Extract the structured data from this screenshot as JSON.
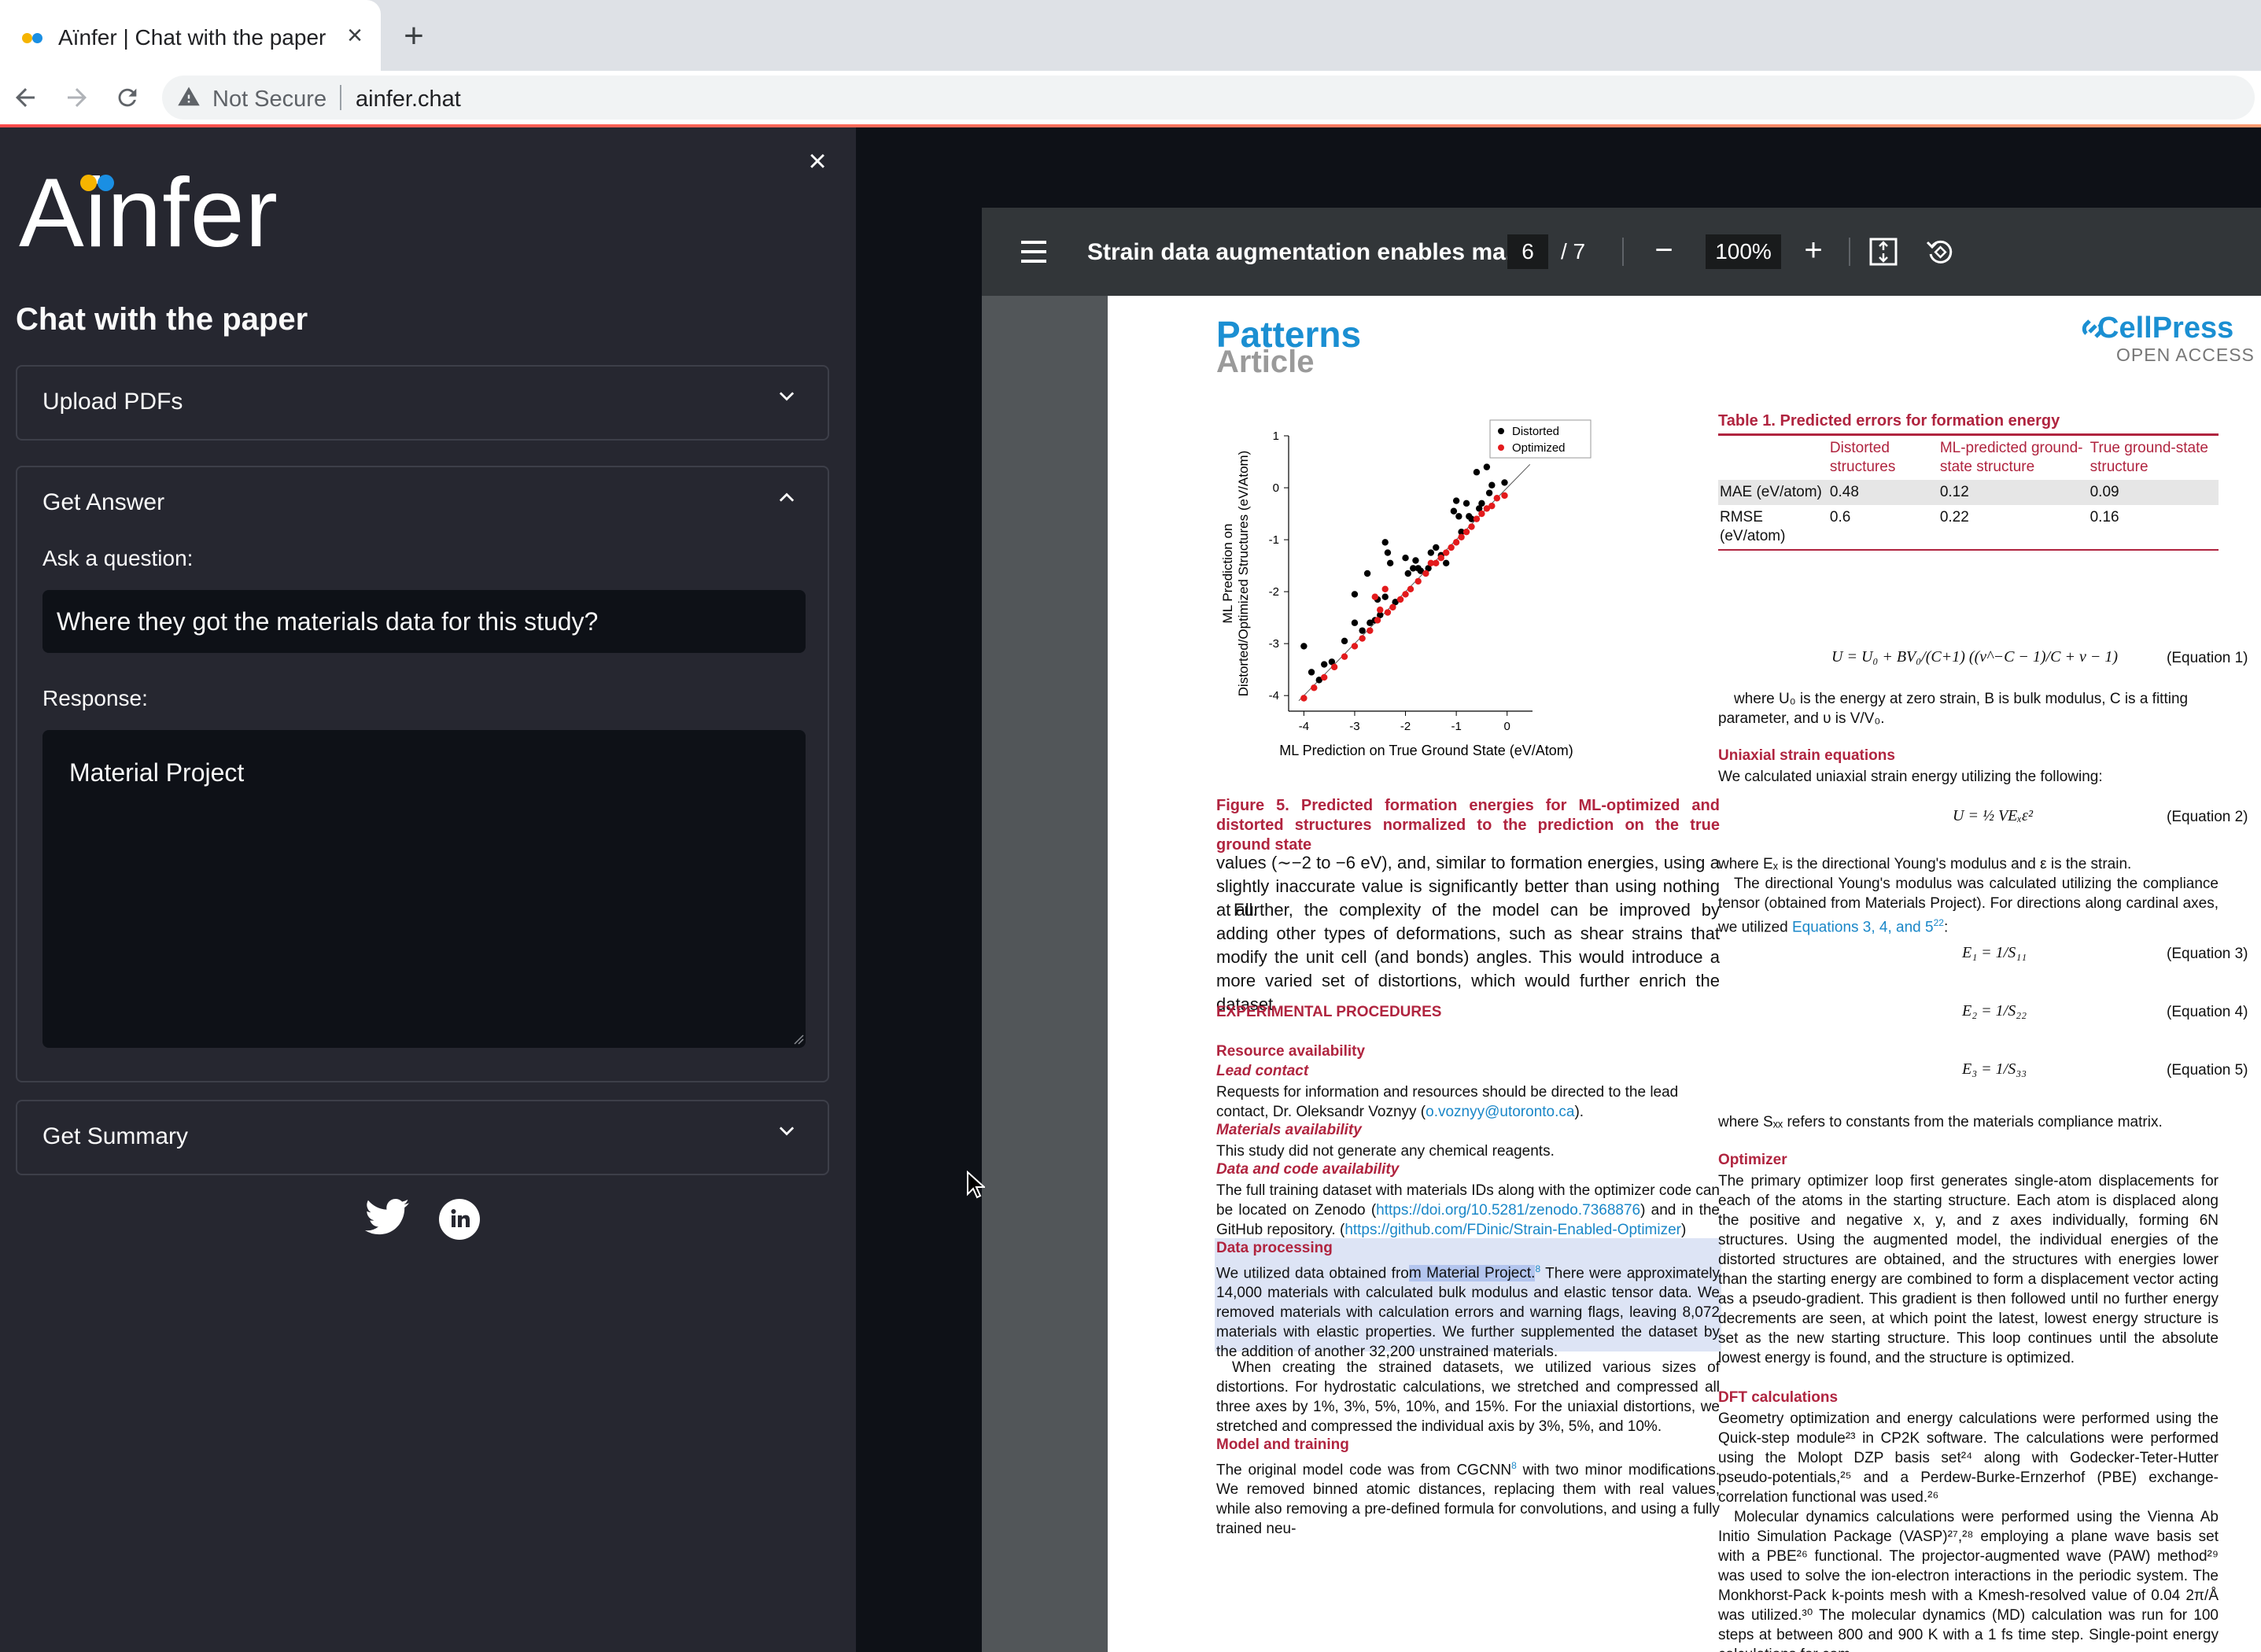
{
  "browser": {
    "tab_title": "Aïnfer | Chat with the paper",
    "not_secure": "Not Secure",
    "url": "ainfer.chat",
    "favicon_colors": [
      "#f5b400",
      "#1a8fe3"
    ]
  },
  "sidebar": {
    "logo_text": "Ainfer",
    "logo_dot_colors": [
      "#f5b400",
      "#1a8fe3"
    ],
    "subtitle": "Chat with the paper",
    "upload_label": "Upload PDFs",
    "get_answer_label": "Get Answer",
    "ask_label": "Ask a question:",
    "question_value": "Where they got the materials data for this study?",
    "response_label": "Response:",
    "response_value": "Material Project",
    "summary_label": "Get Summary",
    "socials": [
      "twitter-icon",
      "linkedin-icon"
    ]
  },
  "pdf": {
    "title": "Strain data augmentation enables ma...",
    "page": "6",
    "page_total": "/ 7",
    "zoom": "100%",
    "journal": "Patterns",
    "article_type": "Article",
    "publisher": "CellPress",
    "open_access": "OPEN ACCESS",
    "figure_caption": "Figure 5. Predicted formation energies for ML-optimized and distorted structures normalized to the prediction on the true ground state",
    "table": {
      "title": "Table 1. Predicted errors for formation energy",
      "columns": [
        "",
        "Distorted structures",
        "ML-predicted ground-state structure",
        "True ground-state structure"
      ],
      "rows": [
        [
          "MAE (eV/atom)",
          "0.48",
          "0.12",
          "0.09"
        ],
        [
          "RMSE (eV/atom)",
          "0.6",
          "0.22",
          "0.16"
        ]
      ]
    },
    "left_col": {
      "para1": "values (∼−2 to −6 eV), and, similar to formation energies, using a slightly inaccurate value is significantly better than using nothing at all.",
      "para2": "Further, the complexity of the model can be improved by adding other types of deformations, such as shear strains that modify the unit cell (and bonds) angles. This would introduce a more varied set of distortions, which would further enrich the dataset.",
      "exp_heading": "EXPERIMENTAL PROCEDURES",
      "resource_heading": "Resource availability",
      "lead_heading": "Lead contact",
      "lead_text": "Requests for information and resources should be directed to the lead contact, Dr. Oleksandr Voznyy (",
      "lead_email": "o.voznyy@utoronto.ca",
      "lead_end": ").",
      "materials_heading": "Materials availability",
      "materials_text": "This study did not generate any chemical reagents.",
      "data_code_heading": "Data and code availability",
      "data_code_text": "The full training dataset with materials IDs along with the optimizer code can be located on Zenodo (",
      "zenodo_link": "https://doi.org/10.5281/zenodo.7368876",
      "data_code_mid": ") and in the GitHub repository. (",
      "github_link": "https://github.com/FDinic/Strain-Enabled-Optimizer",
      "data_code_end": ")",
      "processing_heading": "Data processing",
      "processing_pre": "We utilized data obtained fro",
      "processing_sel": "m Material Project.",
      "processing_ref": "8",
      "processing_post": " There were approximately 14,000 materials with calculated bulk modulus and elastic tensor data. We removed materials with calculation errors and warning flags, leaving 8,072 materials with elastic properties. We further supplemented the dataset by the addition of another 32,200 unstrained materials.",
      "strained_text": "When creating the strained datasets, we utilized various sizes of distortions. For hydrostatic calculations, we stretched and compressed all three axes by 1%, 3%, 5%, 10%, and 15%. For the uniaxial distortions, we stretched and compressed the individual axis by 3%, 5%, and 10%.",
      "model_heading": "Model and training",
      "model_text_a": "The original model code was from CGCNN",
      "model_ref": "8",
      "model_text_b": " with two minor modifications. We removed binned atomic distances, replacing them with real values, while also removing a pre-defined formula for convolutions, and using a fully trained neu-"
    },
    "right_col": {
      "eq1_text": "U = U₀ + BV₀/(C+1) ((ν^−C − 1)/C + ν − 1)",
      "eq1_label": "(Equation 1)",
      "eq1_desc": "where U₀ is the energy at zero strain, B is bulk modulus, C is a fitting parameter, and υ is V/V₀.",
      "uniaxial_heading": "Uniaxial strain equations",
      "uniaxial_text": "We calculated uniaxial strain energy utilizing the following:",
      "eq2_text": "U = ½ VEₓε²",
      "eq2_label": "(Equation 2)",
      "eq2_desc": "where Eₓ is the directional Young's modulus and ε is the strain.",
      "young_text_a": "The directional Young's modulus was calculated utilizing the compliance tensor (obtained from Materials Project). For directions along cardinal axes, we utilized ",
      "young_links": "Equations 3, 4, and 5",
      "young_ref": "22",
      "young_end": ":",
      "eq3_text": "E₁ = 1/S₁₁",
      "eq3_label": "(Equation 3)",
      "eq4_text": "E₂ = 1/S₂₂",
      "eq4_label": "(Equation 4)",
      "eq5_text": "E₃ = 1/S₃₃",
      "eq5_label": "(Equation 5)",
      "sxx_text": "where Sₓₓ refers to constants from the materials compliance matrix.",
      "optimizer_heading": "Optimizer",
      "optimizer_text": "The primary optimizer loop first generates single-atom displacements for each of the atoms in the starting structure. Each atom is displaced along the positive and negative x, y, and z axes individually, forming 6N structures. Using the augmented model, the individual energies of the distorted structures are obtained, and the structures with energies lower than the starting energy are combined to form a displacement vector acting as a pseudo-gradient. This gradient is then followed until no further energy decrements are seen, at which point the latest, lowest energy structure is set as the new starting structure. This loop continues until the absolute lowest energy is found, and the structure is optimized.",
      "dft_heading": "DFT calculations",
      "dft_text": "Geometry optimization and energy calculations were performed using the Quick-step module²³ in CP2K software. The calculations were performed using the Molopt DZP basis set²⁴ along with Godecker-Teter-Hutter pseudo-potentials,²⁵ and a Perdew-Burke-Ernzerhof (PBE) exchange-correlation functional was used.²⁶",
      "md_text": "Molecular dynamics calculations were performed using the Vienna Ab Initio Simulation Package (VASP)²⁷,²⁸ employing a plane wave basis set with a PBE²⁶ functional. The projector-augmented wave (PAW) method²⁹ was used to solve the ion-electron interactions in the periodic system. The Monkhorst-Pack k-points mesh with a Kmesh-resolved value of 0.04 2π/Å was utilized.³⁰ The molecular dynamics (MD) calculation was run for 100 steps at between 800 and 900 K with a 1 fs time step. Single-point energy calculations for com-"
    }
  },
  "chart_data": {
    "type": "scatter",
    "title": "",
    "xlabel": "ML Prediction on True Ground State (eV/Atom)",
    "ylabel": "ML Prediction on Distorted/Optimized Structures (eV/Atom)",
    "xlim": [
      -4.3,
      0.5
    ],
    "ylim": [
      -4.3,
      1
    ],
    "xticks": [
      "-4",
      "-3",
      "-2",
      "-1",
      "0"
    ],
    "yticks": [
      "1",
      "0",
      "-1",
      "-2",
      "-3",
      "-4"
    ],
    "legend_position": "top-right",
    "series": [
      {
        "name": "Distorted",
        "color": "#000000",
        "points": [
          [
            -4,
            -3.05
          ],
          [
            -3.85,
            -3.55
          ],
          [
            -3.7,
            -3.7
          ],
          [
            -3.6,
            -3.4
          ],
          [
            -3.45,
            -3.35
          ],
          [
            -3.2,
            -2.95
          ],
          [
            -3,
            -2.05
          ],
          [
            -3,
            -2.6
          ],
          [
            -2.85,
            -2.75
          ],
          [
            -2.75,
            -1.65
          ],
          [
            -2.7,
            -2.6
          ],
          [
            -2.6,
            -2.55
          ],
          [
            -2.55,
            -2.15
          ],
          [
            -2.5,
            -2.45
          ],
          [
            -2.4,
            -1.05
          ],
          [
            -2.4,
            -2.1
          ],
          [
            -2.35,
            -1.25
          ],
          [
            -2.3,
            -1.45
          ],
          [
            -2.2,
            -2.2
          ],
          [
            -2,
            -1.35
          ],
          [
            -1.95,
            -1.65
          ],
          [
            -1.85,
            -1.55
          ],
          [
            -1.8,
            -1.4
          ],
          [
            -1.75,
            -1.55
          ],
          [
            -1.7,
            -1.6
          ],
          [
            -1.55,
            -1.55
          ],
          [
            -1.5,
            -1.25
          ],
          [
            -1.4,
            -1.15
          ],
          [
            -1.3,
            -1.3
          ],
          [
            -1.2,
            -1.45
          ],
          [
            -1.05,
            -0.45
          ],
          [
            -1,
            -0.25
          ],
          [
            -0.95,
            -0.55
          ],
          [
            -0.9,
            -0.85
          ],
          [
            -0.8,
            -0.3
          ],
          [
            -0.75,
            -0.55
          ],
          [
            -0.7,
            -0.6
          ],
          [
            -0.6,
            0.3
          ],
          [
            -0.55,
            -0.4
          ],
          [
            -0.5,
            -0.3
          ],
          [
            -0.4,
            0.4
          ],
          [
            -0.35,
            -0.1
          ],
          [
            -0.3,
            0.05
          ],
          [
            -0.05,
            0.1
          ]
        ]
      },
      {
        "name": "Optimized",
        "color": "#e31a1c",
        "points": [
          [
            -4,
            -4.05
          ],
          [
            -3.8,
            -3.85
          ],
          [
            -3.6,
            -3.65
          ],
          [
            -3.4,
            -3.45
          ],
          [
            -3.2,
            -3.25
          ],
          [
            -3,
            -3.05
          ],
          [
            -2.85,
            -2.9
          ],
          [
            -2.7,
            -2.75
          ],
          [
            -2.6,
            -2.1
          ],
          [
            -2.55,
            -2.55
          ],
          [
            -2.5,
            -2.35
          ],
          [
            -2.4,
            -1.95
          ],
          [
            -2.35,
            -2.4
          ],
          [
            -2.25,
            -2.3
          ],
          [
            -2.1,
            -2.15
          ],
          [
            -2,
            -2.05
          ],
          [
            -1.9,
            -1.95
          ],
          [
            -1.75,
            -1.8
          ],
          [
            -1.6,
            -1.65
          ],
          [
            -1.5,
            -1.45
          ],
          [
            -1.4,
            -1.45
          ],
          [
            -1.3,
            -1.35
          ],
          [
            -1.2,
            -1.25
          ],
          [
            -1.1,
            -1.15
          ],
          [
            -1,
            -1.05
          ],
          [
            -0.9,
            -0.95
          ],
          [
            -0.8,
            -0.85
          ],
          [
            -0.7,
            -0.75
          ],
          [
            -0.6,
            -0.6
          ],
          [
            -0.5,
            -0.5
          ],
          [
            -0.4,
            -0.4
          ],
          [
            -0.3,
            -0.35
          ],
          [
            -0.2,
            -0.2
          ],
          [
            -0.05,
            -0.15
          ]
        ]
      }
    ],
    "reference_line": "y = x"
  }
}
